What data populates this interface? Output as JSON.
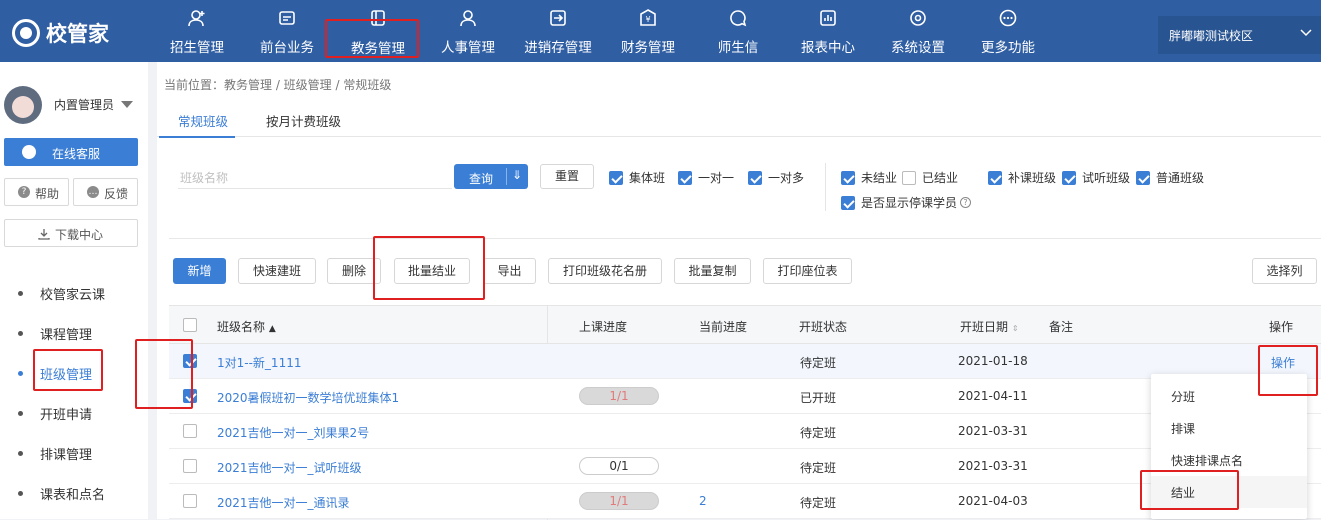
{
  "app": {
    "logo_text": "校管家"
  },
  "nav": {
    "items": [
      {
        "label": "招生管理",
        "icon": "user-plus-icon"
      },
      {
        "label": "前台业务",
        "icon": "reception-icon"
      },
      {
        "label": "教务管理",
        "icon": "class-icon"
      },
      {
        "label": "人事管理",
        "icon": "person-icon"
      },
      {
        "label": "进销存管理",
        "icon": "inventory-icon"
      },
      {
        "label": "财务管理",
        "icon": "finance-icon"
      },
      {
        "label": "师生信",
        "icon": "message-icon"
      },
      {
        "label": "报表中心",
        "icon": "report-icon"
      },
      {
        "label": "系统设置",
        "icon": "settings-icon"
      },
      {
        "label": "更多功能",
        "icon": "more-icon"
      }
    ],
    "campus": "胖嘟嘟测试校区"
  },
  "sidebar": {
    "user": "内置管理员",
    "service_btn": "在线客服",
    "help_btn": "帮助",
    "feedback_btn": "反馈",
    "download_btn": "下载中心",
    "items": [
      {
        "label": "校管家云课"
      },
      {
        "label": "课程管理"
      },
      {
        "label": "班级管理"
      },
      {
        "label": "开班申请"
      },
      {
        "label": "排课管理"
      },
      {
        "label": "课表和点名"
      }
    ]
  },
  "main": {
    "breadcrumb": "当前位置：教务管理 / 班级管理 / 常规班级",
    "tabs": [
      {
        "label": "常规班级"
      },
      {
        "label": "按月计费班级"
      }
    ],
    "search_placeholder": "班级名称",
    "query_btn": "查询",
    "reset_btn": "重置",
    "filters1": [
      "集体班",
      "一对一",
      "一对多"
    ],
    "filters2": [
      "未结业",
      "已结业",
      "补课班级",
      "试听班级",
      "普通班级"
    ],
    "filter_show_stopped": "是否显示停课学员",
    "toolbar": [
      "新增",
      "快速建班",
      "删除",
      "批量结业",
      "导出",
      "打印班级花名册",
      "批量复制",
      "打印座位表"
    ],
    "choose_cols": "选择列"
  },
  "table": {
    "headers": [
      "班级名称",
      "上课进度",
      "当前进度",
      "开班状态",
      "开班日期",
      "备注",
      "操作"
    ],
    "rows": [
      {
        "name": "1对1--新_1111",
        "progress": "",
        "current": "",
        "status": "待定班",
        "date": "2021-01-18",
        "op": "操作"
      },
      {
        "name": "2020暑假班初一数学培优班集体1",
        "progress": "1/1",
        "current": "",
        "status": "已开班",
        "date": "2021-04-11"
      },
      {
        "name": "2021吉他一对一_刘果果2号",
        "progress": "",
        "current": "",
        "status": "待定班",
        "date": "2021-03-31"
      },
      {
        "name": "2021吉他一对一_试听班级",
        "progress": "0/1",
        "current": "",
        "status": "待定班",
        "date": "2021-03-31"
      },
      {
        "name": "2021吉他一对一_通讯录",
        "progress": "1/1",
        "current": "2",
        "status": "待定班",
        "date": "2021-04-03"
      }
    ]
  },
  "dropdown": {
    "items": [
      "分班",
      "排课",
      "快速排课点名",
      "结业"
    ]
  },
  "colors": {
    "primary": "#3b7ed5",
    "topbar": "#2f5ea3",
    "highlight": "#e02020"
  }
}
